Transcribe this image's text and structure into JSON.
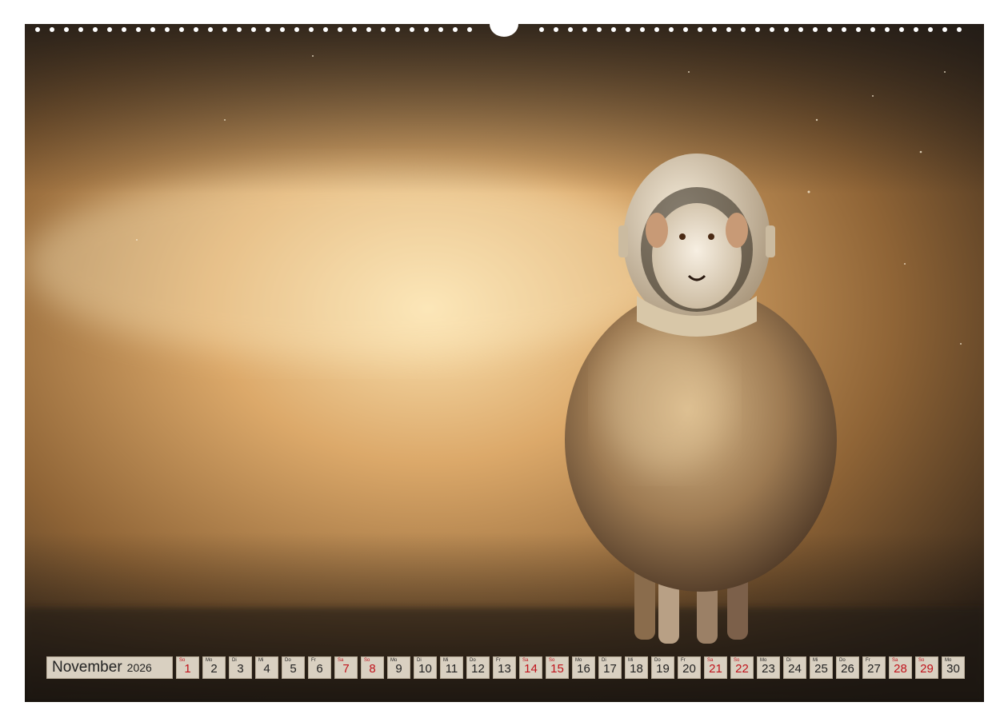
{
  "calendar": {
    "month": "November",
    "year": "2026",
    "days": [
      {
        "wd": "So",
        "n": "1",
        "we": true
      },
      {
        "wd": "Mo",
        "n": "2",
        "we": false
      },
      {
        "wd": "Di",
        "n": "3",
        "we": false
      },
      {
        "wd": "Mi",
        "n": "4",
        "we": false
      },
      {
        "wd": "Do",
        "n": "5",
        "we": false
      },
      {
        "wd": "Fr",
        "n": "6",
        "we": false
      },
      {
        "wd": "Sa",
        "n": "7",
        "we": true
      },
      {
        "wd": "So",
        "n": "8",
        "we": true
      },
      {
        "wd": "Mo",
        "n": "9",
        "we": false
      },
      {
        "wd": "Di",
        "n": "10",
        "we": false
      },
      {
        "wd": "Mi",
        "n": "11",
        "we": false
      },
      {
        "wd": "Do",
        "n": "12",
        "we": false
      },
      {
        "wd": "Fr",
        "n": "13",
        "we": false
      },
      {
        "wd": "Sa",
        "n": "14",
        "we": true
      },
      {
        "wd": "So",
        "n": "15",
        "we": true
      },
      {
        "wd": "Mo",
        "n": "16",
        "we": false
      },
      {
        "wd": "Di",
        "n": "17",
        "we": false
      },
      {
        "wd": "Mi",
        "n": "18",
        "we": false
      },
      {
        "wd": "Do",
        "n": "19",
        "we": false
      },
      {
        "wd": "Fr",
        "n": "20",
        "we": false
      },
      {
        "wd": "Sa",
        "n": "21",
        "we": true
      },
      {
        "wd": "So",
        "n": "22",
        "we": true
      },
      {
        "wd": "Mo",
        "n": "23",
        "we": false
      },
      {
        "wd": "Di",
        "n": "24",
        "we": false
      },
      {
        "wd": "Mi",
        "n": "25",
        "we": false
      },
      {
        "wd": "Do",
        "n": "26",
        "we": false
      },
      {
        "wd": "Fr",
        "n": "27",
        "we": false
      },
      {
        "wd": "Sa",
        "n": "28",
        "we": true
      },
      {
        "wd": "So",
        "n": "29",
        "we": true
      },
      {
        "wd": "Mo",
        "n": "30",
        "we": false
      }
    ]
  },
  "colors": {
    "weekend": "#c0121b",
    "cell": "#d9d0c1"
  }
}
